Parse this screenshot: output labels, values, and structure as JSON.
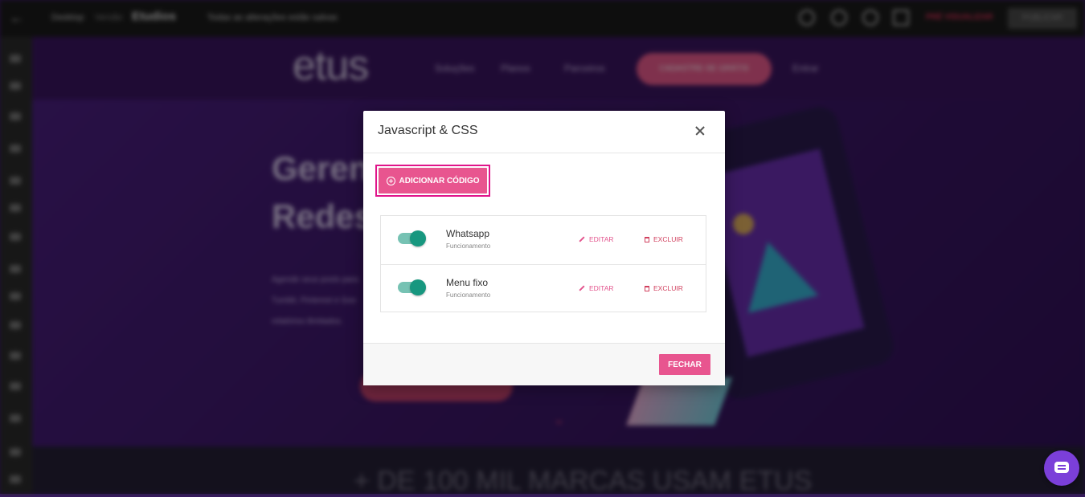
{
  "editor": {
    "topbar": {
      "crumb1": "Desktop",
      "crumb2": "Versão",
      "brand": "Etudios",
      "crumb3": "Todas as alterações estão salvas",
      "preview_label": "PRÉ VISUALIZAR",
      "publish_label": "PUBLICAR"
    }
  },
  "site": {
    "logo": "etus",
    "nav": [
      "Soluções",
      "Planos",
      "Parceiros",
      "Entrar"
    ],
    "cta": "CADASTRE-SE GRÁTIS",
    "hero_title_line1": "Gerenci",
    "hero_title_line2": "Redes",
    "hero_text_line1": "Agende seus posts para",
    "hero_text_line2": "Tumblr, Pinterest e Goo",
    "hero_text_line3": "relatórios ilimitados.",
    "footer_text": "+ DE 100 MIL MARCAS USAM ETUS"
  },
  "modal": {
    "title": "Javascript & CSS",
    "add_button_label": "ADICIONAR CÓDIGO",
    "items": [
      {
        "name": "Whatsapp",
        "status": "Funcionamento",
        "enabled": true,
        "edit_label": "EDITAR",
        "delete_label": "EXCLUIR"
      },
      {
        "name": "Menu fixo",
        "status": "Funcionamento",
        "enabled": true,
        "edit_label": "EDITAR",
        "delete_label": "EXCLUIR"
      }
    ],
    "close_button_label": "FECHAR"
  },
  "colors": {
    "accent_pink": "#e8558f",
    "toggle_on": "#17977f",
    "focus_outline": "#e0148a",
    "chat_bubble": "#7b3fd9"
  },
  "icons": {
    "add": "plus-circle-icon",
    "edit": "pencil-icon",
    "delete": "trash-icon",
    "close": "close-icon",
    "chat": "chat-icon"
  }
}
